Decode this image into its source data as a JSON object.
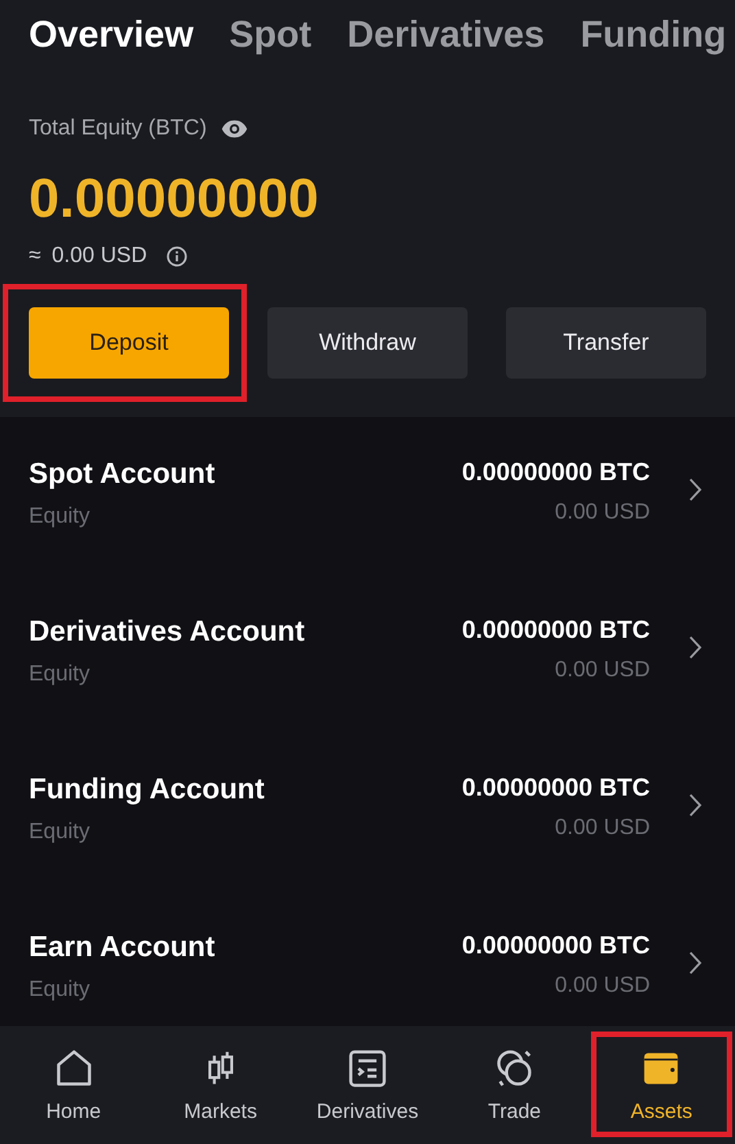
{
  "tabs": [
    {
      "label": "Overview",
      "selected": true
    },
    {
      "label": "Spot",
      "selected": false
    },
    {
      "label": "Derivatives",
      "selected": false
    },
    {
      "label": "Funding",
      "selected": false
    }
  ],
  "summary": {
    "label": "Total Equity (BTC)",
    "value": "0.00000000",
    "approx": "≈",
    "usd": "0.00 USD"
  },
  "actions": [
    {
      "label": "Deposit",
      "kind": "primary",
      "highlighted": true
    },
    {
      "label": "Withdraw",
      "kind": "secondary",
      "highlighted": false
    },
    {
      "label": "Transfer",
      "kind": "secondary",
      "highlighted": false
    }
  ],
  "accounts": [
    {
      "name": "Spot Account",
      "sub": "Equity",
      "btc": "0.00000000 BTC",
      "usd": "0.00 USD"
    },
    {
      "name": "Derivatives Account",
      "sub": "Equity",
      "btc": "0.00000000 BTC",
      "usd": "0.00 USD"
    },
    {
      "name": "Funding Account",
      "sub": "Equity",
      "btc": "0.00000000 BTC",
      "usd": "0.00 USD"
    },
    {
      "name": "Earn Account",
      "sub": "Equity",
      "btc": "0.00000000 BTC",
      "usd": "0.00 USD"
    }
  ],
  "nav": [
    {
      "label": "Home",
      "kind": "home",
      "selected": false,
      "highlighted": false
    },
    {
      "label": "Markets",
      "kind": "markets",
      "selected": false,
      "highlighted": false
    },
    {
      "label": "Derivatives",
      "kind": "derivatives",
      "selected": false,
      "highlighted": false
    },
    {
      "label": "Trade",
      "kind": "trade",
      "selected": false,
      "highlighted": false
    },
    {
      "label": "Assets",
      "kind": "assets",
      "selected": true,
      "highlighted": true
    }
  ]
}
